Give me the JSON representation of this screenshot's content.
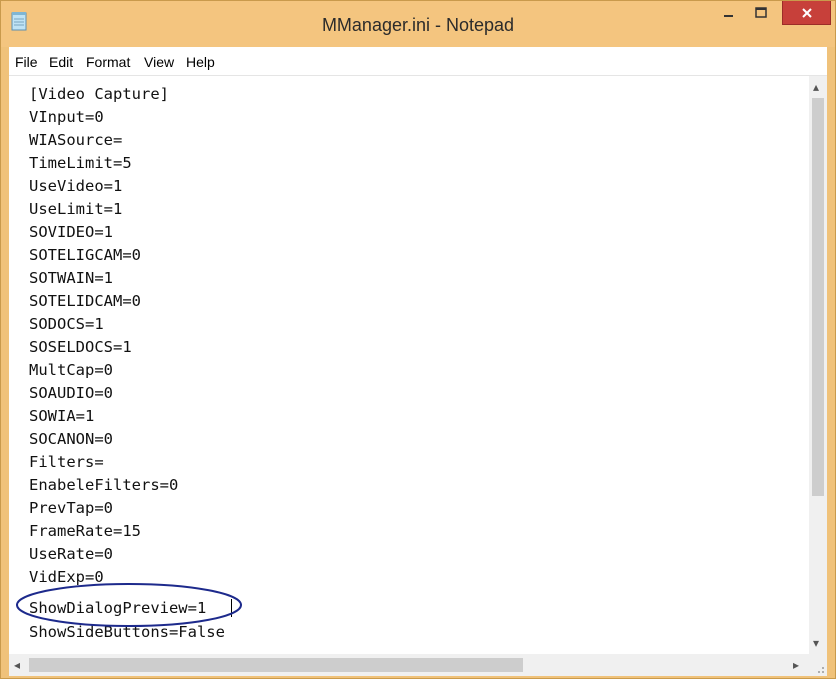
{
  "window": {
    "title": "MManager.ini - Notepad"
  },
  "menu": [
    "File",
    "Edit",
    "Format",
    "View",
    "Help"
  ],
  "lines": [
    "[Video Capture]",
    "VInput=0",
    "WIASource=",
    "TimeLimit=5",
    "UseVideo=1",
    "UseLimit=1",
    "SOVIDEO=1",
    "SOTELIGCAM=0",
    "SOTWAIN=1",
    "SOTELIDCAM=0",
    "SODOCS=1",
    "SOSELDOCS=1",
    "MultCap=0",
    "SOAUDIO=0",
    "SOWIA=1",
    "SOCANON=0",
    "Filters=",
    "EnabeleFilters=0",
    "PrevTap=0",
    "FrameRate=15",
    "UseRate=0",
    "VidExp=0",
    "ShowDialogPreview=1",
    "ShowSideButtons=False"
  ],
  "controls": {
    "minimize_icon": "minimize-icon",
    "maximize_icon": "maximize-icon",
    "close_icon": "close-icon",
    "close_color": "#c7403a"
  }
}
